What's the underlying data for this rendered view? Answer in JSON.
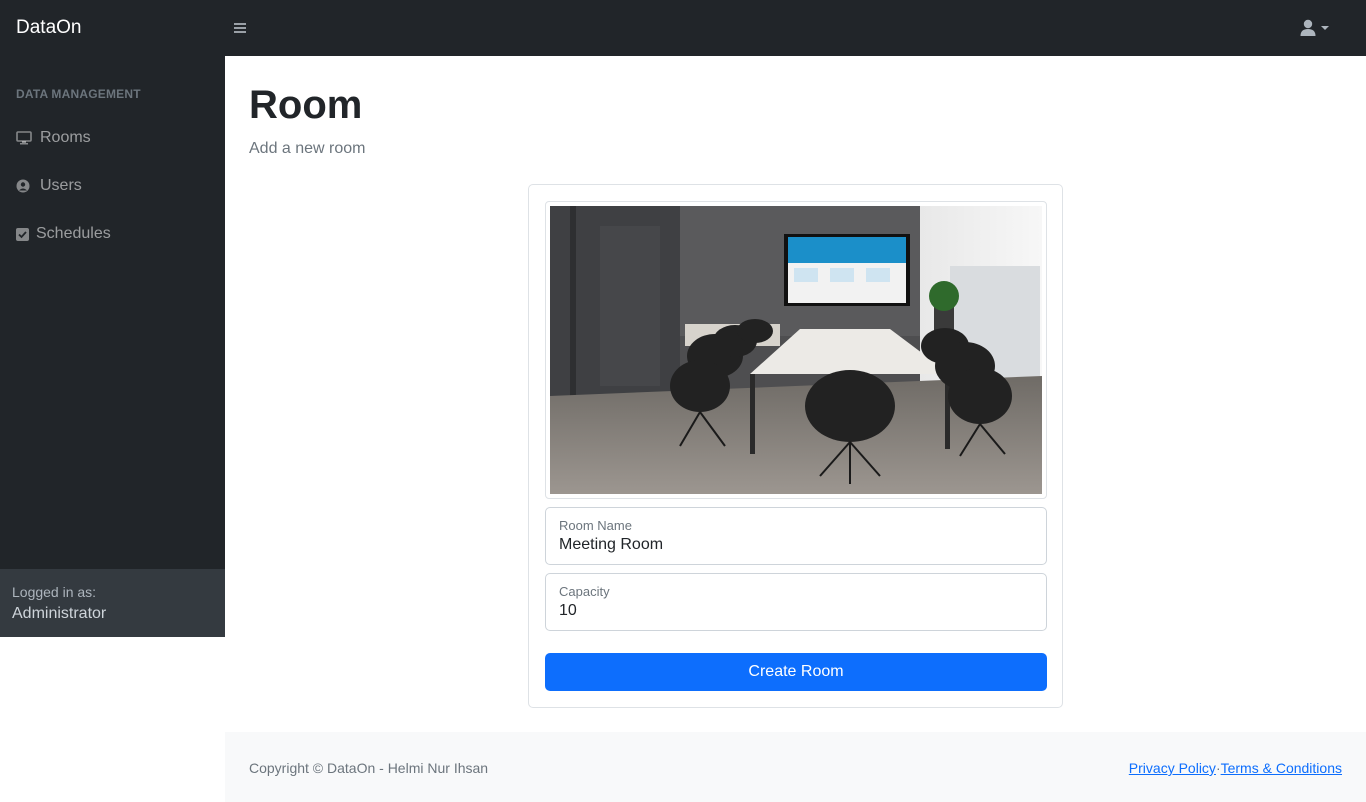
{
  "app": {
    "brand": "DataOn"
  },
  "topbar": {
    "toggle_icon": "hamburger-icon",
    "user_icon": "user-icon"
  },
  "sidebar": {
    "heading": "DATA MANAGEMENT",
    "items": [
      {
        "label": "Rooms",
        "icon": "desktop-icon"
      },
      {
        "label": "Users",
        "icon": "user-circle-icon"
      },
      {
        "label": "Schedules",
        "icon": "checkbox-icon"
      }
    ],
    "footer": {
      "logged_in_label": "Logged in as:",
      "user": "Administrator"
    }
  },
  "main": {
    "title": "Room",
    "subtitle": "Add a new room",
    "form": {
      "room_name": {
        "label": "Room Name",
        "value": "Meeting Room"
      },
      "capacity": {
        "label": "Capacity",
        "value": "10"
      },
      "submit_label": "Create Room"
    }
  },
  "footer": {
    "copyright": "Copyright © DataOn - Helmi Nur Ihsan",
    "privacy": "Privacy Policy",
    "separator": "·",
    "terms": "Terms & Conditions"
  },
  "colors": {
    "navbar": "#212529",
    "sidebar_footer": "#343a40",
    "primary": "#0d6efd",
    "footer_bg": "#f8f9fa"
  }
}
